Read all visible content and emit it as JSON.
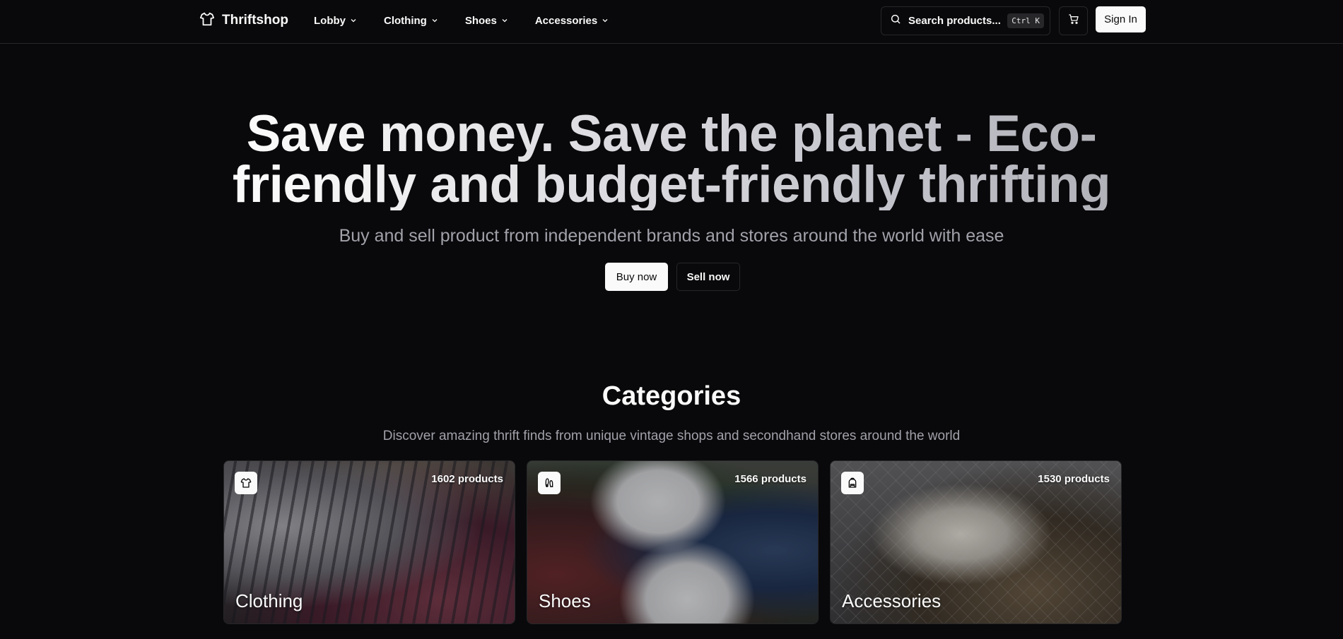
{
  "brand": {
    "name": "Thriftshop",
    "icon": "shirt-icon"
  },
  "nav": {
    "items": [
      {
        "label": "Lobby"
      },
      {
        "label": "Clothing"
      },
      {
        "label": "Shoes"
      },
      {
        "label": "Accessories"
      }
    ]
  },
  "search": {
    "label": "Search products...",
    "shortcut": "Ctrl K"
  },
  "header": {
    "cart_icon": "cart-icon",
    "signin_label": "Sign In"
  },
  "hero": {
    "title_line1": "Save money. Save the planet - Eco-",
    "title_line2": "friendly and budget-friendly thrifting",
    "subtitle": "Buy and sell product from independent brands and stores around the world with ease",
    "buy_label": "Buy now",
    "sell_label": "Sell now"
  },
  "categories": {
    "title": "Categories",
    "subtitle": "Discover amazing thrift finds from unique vintage shops and secondhand stores around the world",
    "items": [
      {
        "name": "Clothing",
        "count": "1602 products",
        "icon": "shirt-icon"
      },
      {
        "name": "Shoes",
        "count": "1566 products",
        "icon": "footprints-icon"
      },
      {
        "name": "Accessories",
        "count": "1530 products",
        "icon": "backpack-icon"
      }
    ]
  },
  "colors": {
    "background": "#09090b",
    "foreground": "#fafafa",
    "muted": "#a1a1aa",
    "border": "#27272a"
  }
}
